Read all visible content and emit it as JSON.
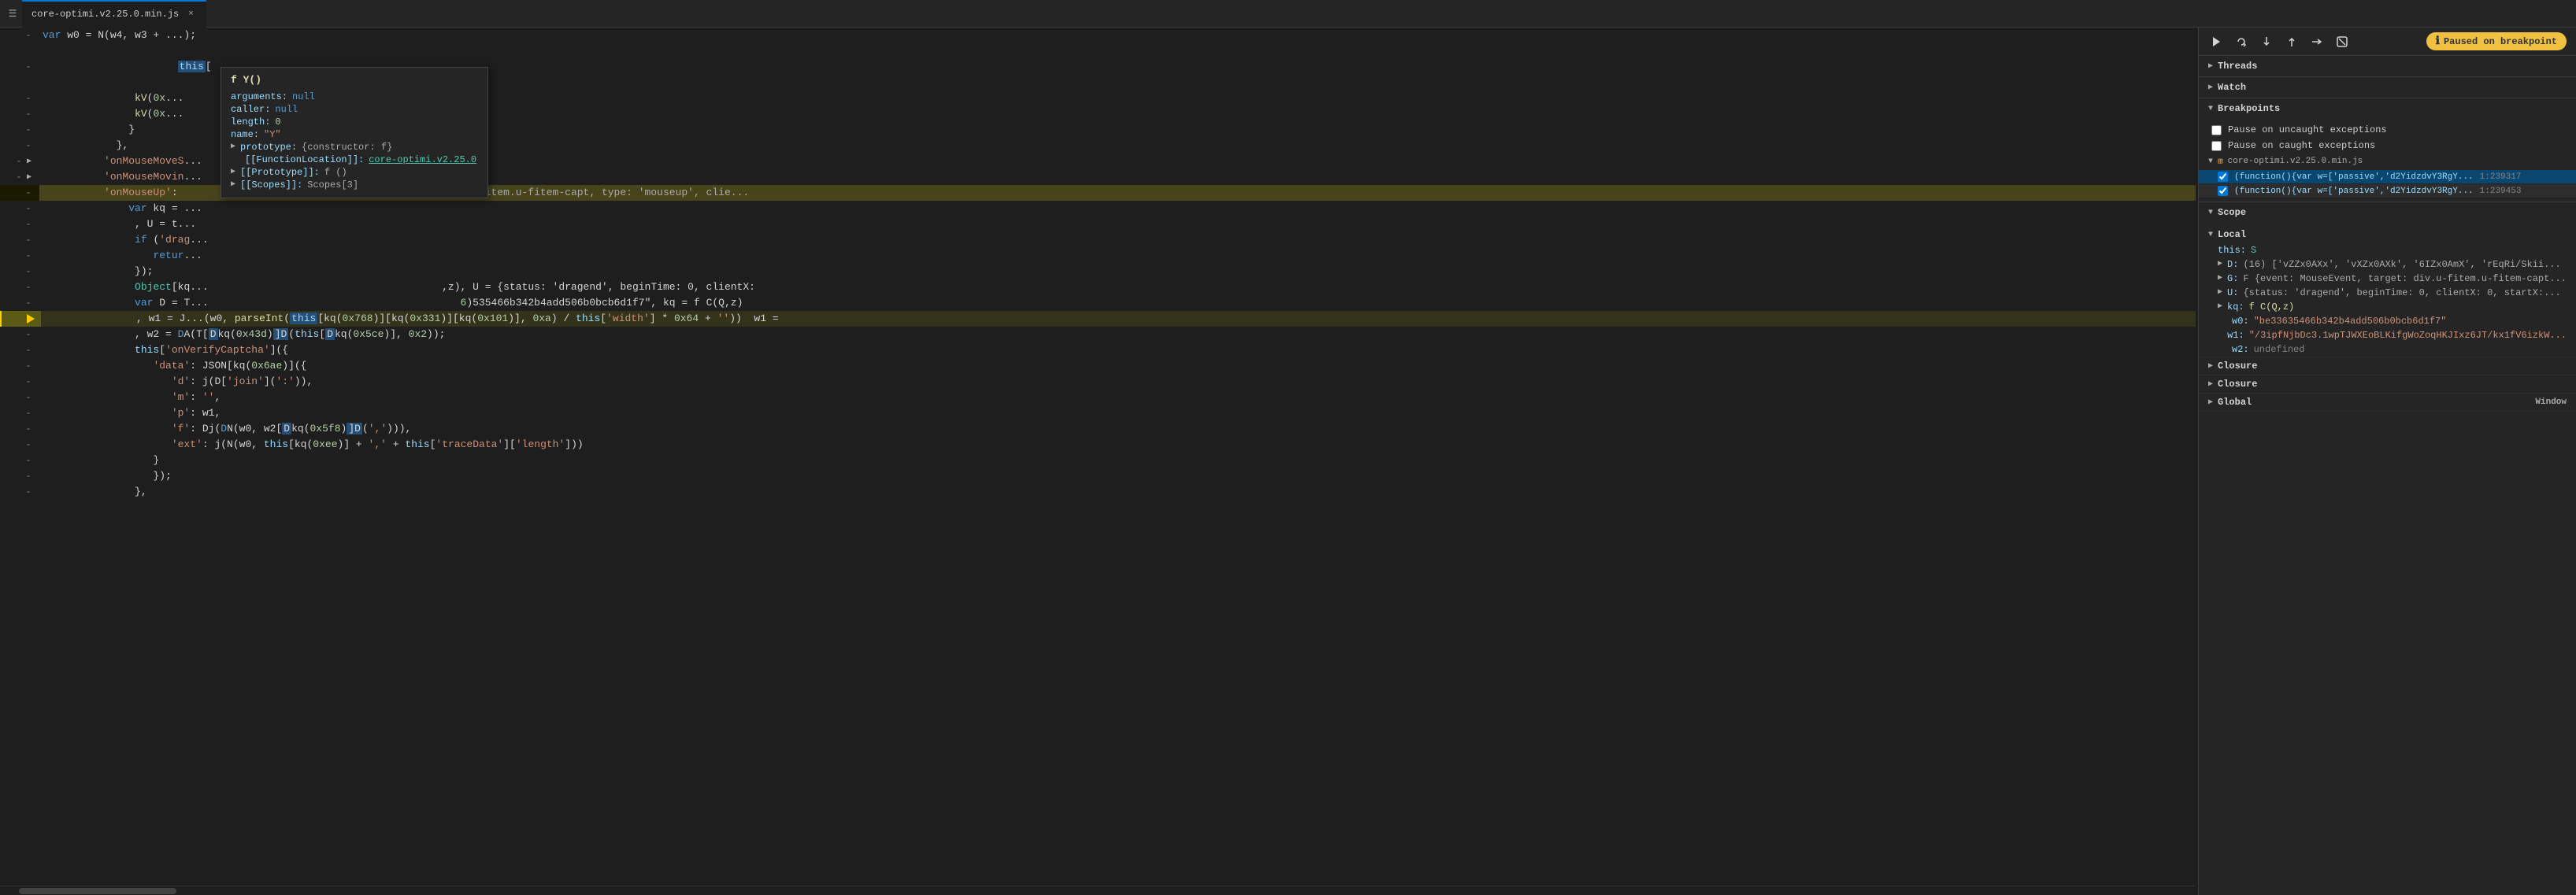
{
  "tab": {
    "label": "core-optimi.v2.25.0.min.js",
    "icon": "{}",
    "close": "×"
  },
  "debugger": {
    "paused_label": "Paused on breakpoint",
    "buttons": {
      "resume": "▶",
      "step_over": "↺",
      "step_into": "↓",
      "step_out": "↑",
      "step_instruction": "→",
      "deactivate": "⬚"
    }
  },
  "panels": {
    "threads_label": "Threads",
    "watch_label": "Watch",
    "breakpoints_label": "Breakpoints",
    "pause_uncaught_label": "Pause on uncaught exceptions",
    "pause_caught_label": "Pause on caught exceptions",
    "file_label": "core-optimi.v2.25.0.min.js",
    "bp1_code": "(function(){var w=['passive','d2YidzdvY3RgY...",
    "bp1_location": "1:239317",
    "bp2_code": "(function(){var w=['passive','d2YidzdvY3RgY...",
    "bp2_location": "1:239453",
    "scope_label": "Scope",
    "local_label": "Local",
    "scope_this": "this: S",
    "scope_d_label": "D:",
    "scope_d_value": "(16) ['vZZx0AXx', 'vXZx0AXk', '6IZx0AmX', 'rEqRi/Skii...",
    "scope_G_label": "G:",
    "scope_G_value": "F {event: MouseEvent, target: div.u-fitem.u-fitem-capt...",
    "scope_U_label": "U:",
    "scope_U_value": "{status: 'dragend', beginTime: 0, clientX: 0, startX:...",
    "scope_kq_label": "kq:",
    "scope_kq_value": "f C(Q,z)",
    "scope_w0_label": "w0:",
    "scope_w0_value": "\"be33635466b342b4add506b0bcb6d1f7\"",
    "scope_w1_label": "w1:",
    "scope_w1_value": "\"/3ipfNjbDc3.1wpTJWXEoBLKifgWoZoqHKJIxz6JT/kx1fV6izkW...",
    "scope_w2_label": "w2:",
    "scope_w2_value": "undefined",
    "closure_label": "Closure",
    "closure2_label": "Closure",
    "global_label": "Global",
    "window_label": "Window"
  },
  "tooltip": {
    "title": "f Y()",
    "rows": [
      {
        "key": "arguments:",
        "val": "null",
        "type": "null"
      },
      {
        "key": "caller:",
        "val": "null",
        "type": "null"
      },
      {
        "key": "length:",
        "val": "0",
        "type": "num"
      },
      {
        "key": "name:",
        "val": "\"Y\"",
        "type": "str"
      },
      {
        "key": "prototype:",
        "val": "{constructor: f}",
        "type": "obj",
        "expand": true
      },
      {
        "key": "[[FunctionLocation]]:",
        "val": "core-optimi.v2.25.0",
        "type": "link"
      },
      {
        "key": "[[Prototype]]:",
        "val": "f ()",
        "type": "obj",
        "expand": true
      },
      {
        "key": "[[Scopes]]:",
        "val": "Scopes[3]",
        "type": "obj",
        "expand": true
      }
    ]
  },
  "code": {
    "lines": [
      {
        "num": "",
        "indent": 6,
        "text": "var w0 = N(w4, w3 + ...);"
      },
      {
        "num": "",
        "indent": 7,
        "text": "this[",
        "has_this": true
      },
      {
        "num": "",
        "indent": 7,
        "text": "kV(0x..."
      },
      {
        "num": "",
        "indent": 7,
        "text": "kV(0x..."
      },
      {
        "num": "",
        "indent": 6,
        "text": "}"
      },
      {
        "num": "",
        "indent": 5,
        "text": "},"
      },
      {
        "num": "",
        "indent": 4,
        "text": "'onMouseMoveS..."
      },
      {
        "num": "",
        "indent": 4,
        "text": "'onMouseMovin..."
      },
      {
        "num": "",
        "indent": 4,
        "text": "'onMouseUp': ..."
      },
      {
        "num": "",
        "indent": 5,
        "text": "var kq = ..."
      },
      {
        "num": "",
        "indent": 5,
        "text": ", U = t..."
      },
      {
        "num": "",
        "indent": 5,
        "text": "if ('drag..."
      },
      {
        "num": "",
        "indent": 6,
        "text": "retur..."
      },
      {
        "num": "",
        "indent": 5,
        "text": "});"
      },
      {
        "num": "",
        "indent": 5,
        "text": "Object[kq..."
      },
      {
        "num": "",
        "indent": 5,
        "text": "var D = T..."
      },
      {
        "num": "",
        "active": true,
        "indent": 5,
        "text": ", w1 = J...(w0, parseInt(this[kq(0x768)][kq(0x331)][kq(0x101)], 0xa) / this['width'] * 0x64 + '')) w1 ="
      },
      {
        "num": "",
        "indent": 5,
        "text": ", w2 = DA(T[Dkq(0x43d)]D(this[Dkq(0x5ce)], 0x2));"
      },
      {
        "num": "",
        "indent": 4,
        "text": "this['onVerifyCaptcha']({"
      },
      {
        "num": "",
        "indent": 5,
        "text": "'data': JSON[kq(0x6ae)]({"
      },
      {
        "num": "",
        "indent": 6,
        "text": "'d': j(D['join'](':')),"
      },
      {
        "num": "",
        "indent": 6,
        "text": "'m': '',"
      },
      {
        "num": "",
        "indent": 6,
        "text": "'p': w1,"
      },
      {
        "num": "",
        "indent": 6,
        "text": "'f': Dj(DN(w0, w2[Dkq(0x5f8)]D(','))),"
      },
      {
        "num": "",
        "indent": 6,
        "text": "'ext': j(N(w0, this[kq(0xee)] + ',' + this['traceData']['length']))"
      },
      {
        "num": "",
        "indent": 5,
        "text": "})"
      },
      {
        "num": "",
        "indent": 4,
        "text": "});"
      },
      {
        "num": "",
        "indent": 3,
        "text": "},"
      }
    ]
  }
}
